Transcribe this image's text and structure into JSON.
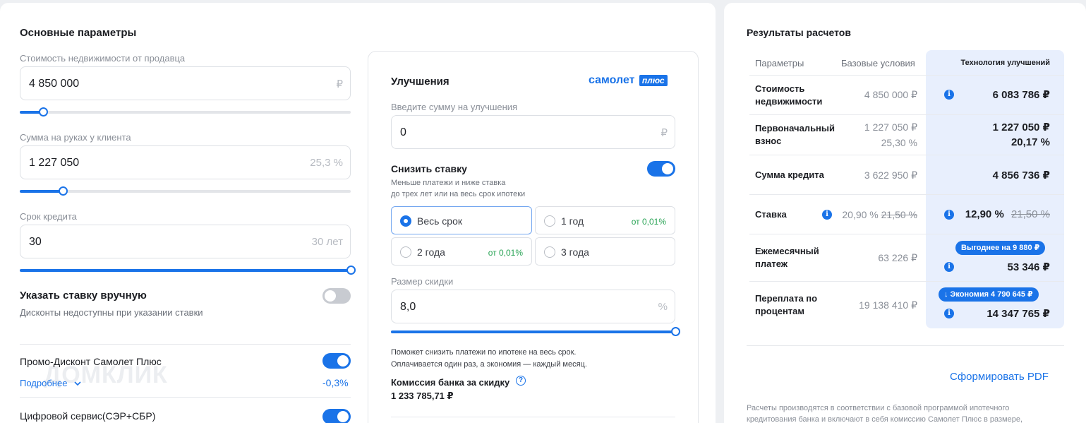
{
  "main": {
    "title": "Основные параметры",
    "price": {
      "label": "Стоимость недвижимости от продавца",
      "value": "4 850 000",
      "suffix": "₽",
      "slider_fraction": 0.07
    },
    "cash": {
      "label": "Сумма на руках у клиента",
      "value": "1 227 050",
      "suffix": "25,3 %",
      "slider_fraction": 0.13
    },
    "term": {
      "label": "Срок кредита",
      "value": "30",
      "suffix": "30 лет",
      "slider_fraction": 1.0
    },
    "manual_rate": {
      "title": "Указать ставку вручную",
      "note": "Дисконты недоступны при указании ставки",
      "enabled": false
    },
    "promo": {
      "label": "Промо-Дисконт Самолет Плюс",
      "more": "Подробнее",
      "value": "-0,3%",
      "enabled": true
    },
    "digital": {
      "label": "Цифровой сервис(СЭР+СБР)",
      "enabled": true
    },
    "watermark": "ДОМКЛИК"
  },
  "improvements": {
    "title": "Улучшения",
    "brand": "самолет",
    "brand_badge": "плюс",
    "amount_label": "Введите сумму на улучшения",
    "amount_value": "0",
    "amount_suffix": "₽",
    "reduce": {
      "title": "Снизить ставку",
      "desc1": "Меньше платежи и ниже ставка",
      "desc2": "до трех лет или на весь срок ипотеки",
      "enabled": true
    },
    "options": [
      {
        "label": "Весь срок",
        "note": "",
        "selected": true
      },
      {
        "label": "1 год",
        "note": "от 0,01%",
        "selected": false
      },
      {
        "label": "2 года",
        "note": "от 0,01%",
        "selected": false
      },
      {
        "label": "3 года",
        "note": "",
        "selected": false
      }
    ],
    "discount_label": "Размер скидки",
    "discount_value": "8,0",
    "discount_suffix": "%",
    "discount_slider_fraction": 1.0,
    "help1": "Поможет снизить платежи по ипотеке на весь срок.",
    "help2": "Оплачивается один раз, а экономия — каждый месяц.",
    "commission_label": "Комиссия банка за скидку",
    "commission_value": "1 233 785,71 ₽"
  },
  "results": {
    "title": "Результаты расчетов",
    "headers": {
      "params": "Параметры",
      "base": "Базовые условия",
      "tech": "Технология улучшений"
    },
    "rows": {
      "price": {
        "label1": "Стоимость",
        "label2": "недвижимости",
        "base": "4 850 000 ₽",
        "tech": "6 083 786 ₽"
      },
      "down": {
        "label1": "Первоначальный",
        "label2": "взнос",
        "base1": "1 227 050 ₽",
        "base2": "25,30 %",
        "tech1": "1 227 050 ₽",
        "tech2": "20,17 %"
      },
      "loan": {
        "label": "Сумма кредита",
        "base": "3 622 950 ₽",
        "tech": "4 856 736 ₽"
      },
      "rate": {
        "label": "Ставка",
        "base": "20,90 %",
        "base_old": "21,50 %",
        "tech": "12,90 %",
        "tech_old": "21,50 %"
      },
      "monthly": {
        "label1": "Ежемесячный",
        "label2": "платеж",
        "base": "63 226 ₽",
        "pill": "Выгоднее на 9 880 ₽",
        "tech": "53 346 ₽"
      },
      "overpay": {
        "label1": "Переплата по",
        "label2": "процентам",
        "base": "19 138 410 ₽",
        "pill": "↓ Экономия 4 790 645 ₽",
        "tech": "14 347 765 ₽"
      }
    },
    "pdf_link": "Сформировать PDF",
    "footnote1": "Расчеты производятся в соответствии с базовой программой ипотечного",
    "footnote2": "кредитования банка и включают в себя комиссию Самолет Плюс в размере,"
  },
  "colors": {
    "accent": "#1a73e8",
    "highlight": "#e8effd",
    "green": "#2aa456"
  }
}
